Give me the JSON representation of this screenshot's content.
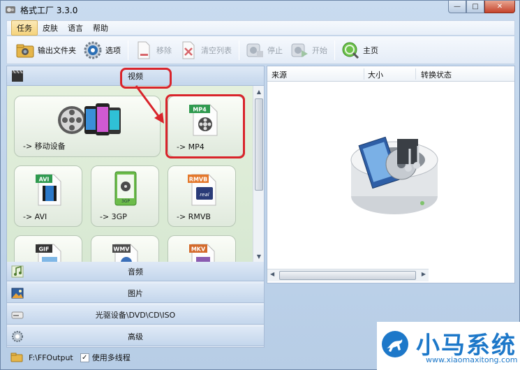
{
  "window": {
    "title": "格式工厂 3.3.0",
    "minimize": "—",
    "maximize": "□",
    "close": "✕"
  },
  "menu": {
    "items": [
      {
        "label": "任务",
        "active": true
      },
      {
        "label": "皮肤"
      },
      {
        "label": "语言"
      },
      {
        "label": "帮助"
      }
    ]
  },
  "toolbar": {
    "output_folder": "输出文件夹",
    "options": "选项",
    "remove": "移除",
    "clear_list": "清空列表",
    "stop": "停止",
    "start": "开始",
    "home": "主页"
  },
  "categories": {
    "video": "视频",
    "audio": "音频",
    "picture": "图片",
    "rom": "光驱设备\\DVD\\CD\\ISO",
    "advanced": "高级"
  },
  "tiles": {
    "mobile": {
      "label": "-> 移动设备"
    },
    "mp4": {
      "label": "-> MP4",
      "badge": "MP4"
    },
    "avi": {
      "label": "-> AVI",
      "badge": "AVI"
    },
    "gp3": {
      "label": "-> 3GP",
      "badge": "3GP"
    },
    "rmvb": {
      "label": "-> RMVB",
      "badge": "RMVB",
      "badge2": "real"
    },
    "gif": {
      "badge": "GIF"
    },
    "wmv": {
      "badge": "WMV"
    },
    "mkv": {
      "badge": "MKV"
    }
  },
  "grid": {
    "columns": [
      "来源",
      "大小",
      "转换状态"
    ]
  },
  "status": {
    "output_path": "F:\\FFOutput",
    "multithread_label": "使用多线程",
    "multithread_checked": true,
    "check": "✓"
  },
  "watermark": {
    "text": "小马系统",
    "url": "www.xiaomaxitong.com"
  },
  "colors": {
    "accent": "#1d78c9",
    "annotation": "#d9242b"
  }
}
